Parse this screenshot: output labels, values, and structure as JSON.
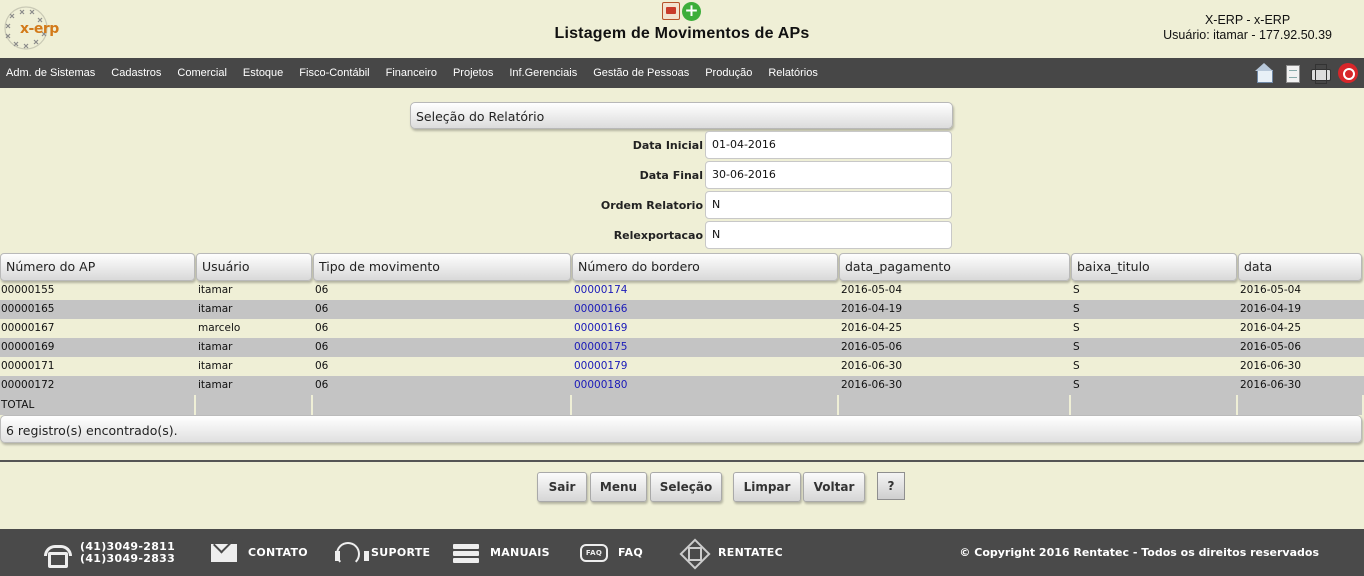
{
  "header": {
    "logo_text": "x-erp",
    "title": "Listagem de Movimentos de APs",
    "system_name": "X-ERP - x-ERP",
    "user_info": "Usuário: itamar - 177.92.50.39"
  },
  "menu": {
    "items": [
      "Adm. de Sistemas",
      "Cadastros",
      "Comercial",
      "Estoque",
      "Fisco-Contábil",
      "Financeiro",
      "Projetos",
      "Inf.Gerenciais",
      "Gestão de Pessoas",
      "Produção",
      "Relatórios"
    ],
    "icons": [
      "home-icon",
      "document-icon",
      "print-icon",
      "power-icon"
    ]
  },
  "selection": {
    "title": "Seleção do Relatório",
    "fields": [
      {
        "label": "Data Inicial",
        "value": "01-04-2016"
      },
      {
        "label": "Data Final",
        "value": "30-06-2016"
      },
      {
        "label": "Ordem Relatorio",
        "value": "N"
      },
      {
        "label": "Relexportacao",
        "value": "N"
      }
    ]
  },
  "table": {
    "columns": [
      "Número do AP",
      "Usuário",
      "Tipo de movimento",
      "Número do bordero",
      "data_pagamento",
      "baixa_titulo",
      "data"
    ],
    "rows": [
      [
        "00000155",
        "itamar",
        "06",
        "00000174",
        "2016-05-04",
        "S",
        "2016-05-04"
      ],
      [
        "00000165",
        "itamar",
        "06",
        "00000166",
        "2016-04-19",
        "S",
        "2016-04-19"
      ],
      [
        "00000167",
        "marcelo",
        "06",
        "00000169",
        "2016-04-25",
        "S",
        "2016-04-25"
      ],
      [
        "00000169",
        "itamar",
        "06",
        "00000175",
        "2016-05-06",
        "S",
        "2016-05-06"
      ],
      [
        "00000171",
        "itamar",
        "06",
        "00000179",
        "2016-06-30",
        "S",
        "2016-06-30"
      ],
      [
        "00000172",
        "itamar",
        "06",
        "00000180",
        "2016-06-30",
        "S",
        "2016-06-30"
      ]
    ],
    "total_label": "TOTAL",
    "count_text": "6 registro(s) encontrado(s)."
  },
  "buttons": {
    "sair": "Sair",
    "menu": "Menu",
    "selecao": "Seleção",
    "limpar": "Limpar",
    "voltar": "Voltar",
    "help": "?"
  },
  "footer": {
    "phone1": "(41)3049-2811",
    "phone2": "(41)3049-2833",
    "contato": "CONTATO",
    "suporte": "SUPORTE",
    "manuais": "MANUAIS",
    "faq": "FAQ",
    "faq_icon_text": "FAQ",
    "rentatec": "RENTATEC",
    "copyright": "© Copyright 2016 Rentatec - Todos os direitos reservados"
  },
  "colors": {
    "background": "#efefd6",
    "menubar": "#474747",
    "footer": "#4a4a4a",
    "link": "#1a1ab8",
    "row_alt": "#c4c4c4",
    "logo": "#d37a1a"
  }
}
